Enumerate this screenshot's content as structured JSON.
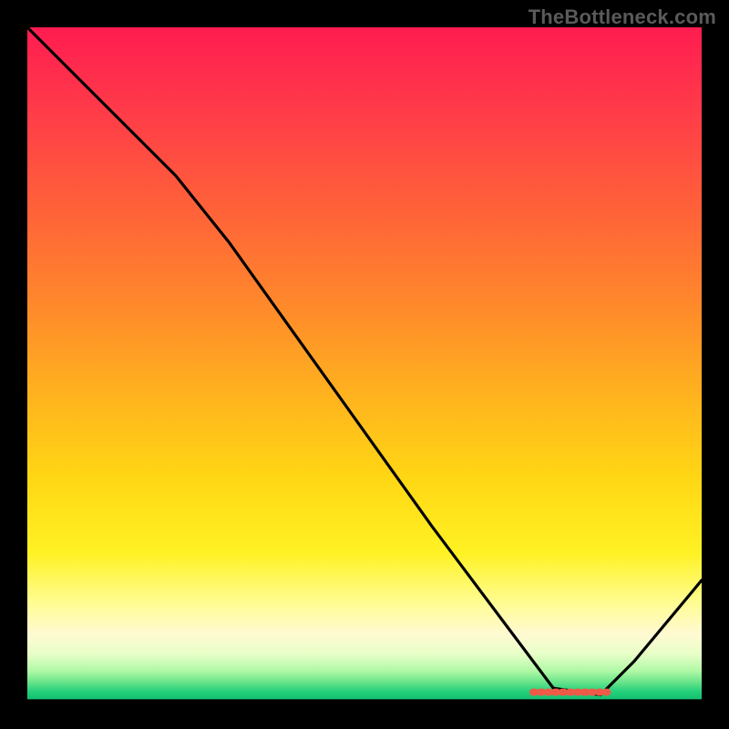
{
  "watermark": "TheBottleneck.com",
  "chart_data": {
    "type": "line",
    "title": "",
    "xlabel": "",
    "ylabel": "",
    "xlim": [
      0,
      100
    ],
    "ylim": [
      0,
      100
    ],
    "series": [
      {
        "name": "curve",
        "x": [
          0,
          8,
          22,
          30,
          45,
          60,
          72,
          78,
          85,
          90,
          100
        ],
        "y": [
          100,
          92,
          78,
          68,
          47,
          26,
          10,
          2,
          1,
          6,
          18
        ]
      }
    ],
    "marker": {
      "name": "flat-region",
      "x_start": 75,
      "x_end": 86,
      "y": 1
    },
    "gradient_stops": [
      {
        "pos": 0.0,
        "color": "#ff1c50"
      },
      {
        "pos": 0.28,
        "color": "#ff6438"
      },
      {
        "pos": 0.55,
        "color": "#ffb41e"
      },
      {
        "pos": 0.78,
        "color": "#fff224"
      },
      {
        "pos": 0.9,
        "color": "#fffad2"
      },
      {
        "pos": 1.0,
        "color": "#0dba6e"
      }
    ]
  }
}
